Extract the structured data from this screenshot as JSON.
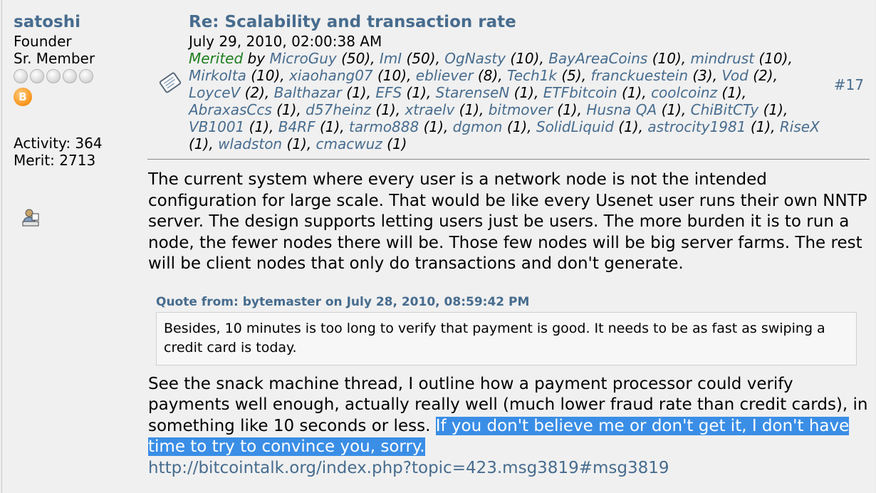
{
  "poster": {
    "name": "satoshi",
    "title1": "Founder",
    "title2": "Sr. Member",
    "badge_label": "B",
    "activity_label": "Activity: 364",
    "merit_label": "Merit: 2713"
  },
  "post": {
    "subject": "Re: Scalability and transaction rate",
    "date": "July 29, 2010, 02:00:38 AM",
    "number": "#17",
    "merited_label": "Merited",
    "merited_by": "by",
    "merits": [
      {
        "user": "MicroGuy",
        "count": "(50)"
      },
      {
        "user": "ImI",
        "count": "(50)"
      },
      {
        "user": "OgNasty",
        "count": "(10)"
      },
      {
        "user": "BayAreaCoins",
        "count": "(10)"
      },
      {
        "user": "mindrust",
        "count": "(10)"
      },
      {
        "user": "MirkoIta",
        "count": "(10)"
      },
      {
        "user": "xiaohang07",
        "count": "(10)"
      },
      {
        "user": "ebliever",
        "count": "(8)"
      },
      {
        "user": "Tech1k",
        "count": "(5)"
      },
      {
        "user": "franckuestein",
        "count": "(3)"
      },
      {
        "user": "Vod",
        "count": "(2)"
      },
      {
        "user": "LoyceV",
        "count": "(2)"
      },
      {
        "user": "Balthazar",
        "count": "(1)"
      },
      {
        "user": "EFS",
        "count": "(1)"
      },
      {
        "user": "StarenseN",
        "count": "(1)"
      },
      {
        "user": "ETFbitcoin",
        "count": "(1)"
      },
      {
        "user": "coolcoinz",
        "count": "(1)"
      },
      {
        "user": "AbraxasCcs",
        "count": "(1)"
      },
      {
        "user": "d57heinz",
        "count": "(1)"
      },
      {
        "user": "xtraelv",
        "count": "(1)"
      },
      {
        "user": "bitmover",
        "count": "(1)"
      },
      {
        "user": "Husna QA",
        "count": "(1)"
      },
      {
        "user": "ChiBitCTy",
        "count": "(1)"
      },
      {
        "user": "VB1001",
        "count": "(1)"
      },
      {
        "user": "B4RF",
        "count": "(1)"
      },
      {
        "user": "tarmo888",
        "count": "(1)"
      },
      {
        "user": "dgmon",
        "count": "(1)"
      },
      {
        "user": "SolidLiquid",
        "count": "(1)"
      },
      {
        "user": "astrocity1981",
        "count": "(1)"
      },
      {
        "user": "RiseX",
        "count": "(1)"
      },
      {
        "user": "wladston",
        "count": "(1)"
      },
      {
        "user": "cmacwuz",
        "count": "(1)"
      }
    ],
    "body_para1": "The current system where every user is a network node is not the intended configuration for large scale.  That would be like every Usenet user runs their own NNTP server.  The design supports letting users just be users.  The more burden it is to run a node, the fewer nodes there will be.  Those few nodes will be big server farms.  The rest will be client nodes that only do transactions and don't generate.",
    "quote_header": "Quote from: bytemaster on July 28, 2010, 08:59:42 PM",
    "quote_text": "Besides, 10 minutes is too long to verify that payment is good.  It needs to be as fast as swiping a credit card is today.",
    "body_para2_plain": "See the snack machine thread, I outline how a payment processor could verify payments well enough, actually really well (much lower fraud rate than credit cards), in something like 10 seconds or less. ",
    "body_para2_selected": " If you don't believe me or don't get it, I don't have time to try to convince you, sorry.",
    "link": "http://bitcointalk.org/index.php?topic=423.msg3819#msg3819"
  },
  "colors": {
    "link": "#476c8e",
    "merited": "#1e7e1e",
    "selection": "#3a8ee6",
    "bitcoin": "#f7931a"
  }
}
